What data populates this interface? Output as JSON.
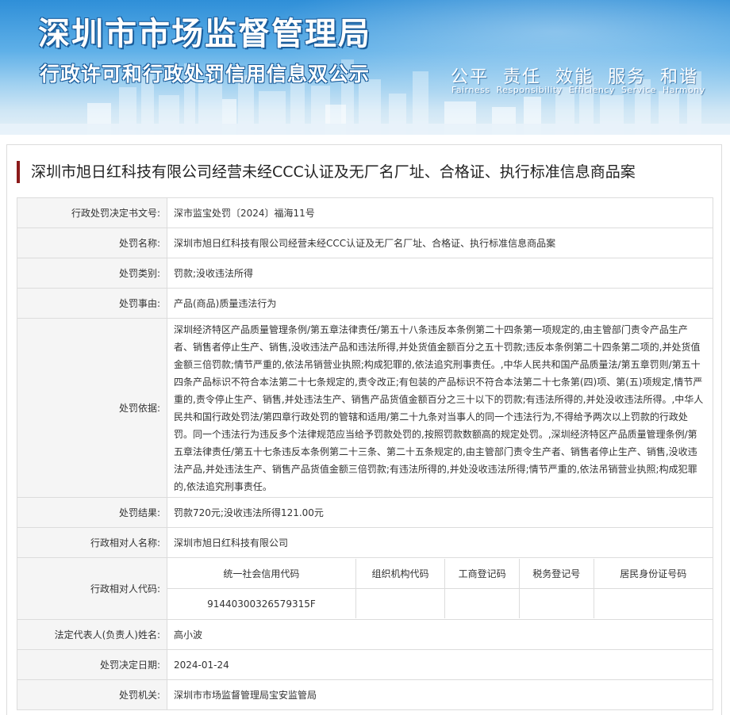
{
  "banner": {
    "title": "深圳市市场监督管理局",
    "subtitle": "行政许可和行政处罚信用信息双公示",
    "values_cn": "公平  责任  效能  服务  和谐",
    "values_en": "Fairness  Responsibility  Efficiency  Service  Harmony"
  },
  "case_title": "深圳市旭日红科技有限公司经营未经CCC认证及无厂名厂址、合格证、执行标准信息商品案",
  "rows": {
    "doc_no": {
      "label": "行政处罚决定书文号:",
      "value": "深市监宝处罚〔2024〕福海11号"
    },
    "name": {
      "label": "处罚名称:",
      "value": "深圳市旭日红科技有限公司经营未经CCC认证及无厂名厂址、合格证、执行标准信息商品案"
    },
    "category": {
      "label": "处罚类别:",
      "value": "罚款;没收违法所得"
    },
    "reason": {
      "label": "处罚事由:",
      "value": "产品(商品)质量违法行为"
    },
    "basis": {
      "label": "处罚依据:",
      "value": "深圳经济特区产品质量管理条例/第五章法律责任/第五十八条违反本条例第二十四条第一项规定的,由主管部门责令产品生产者、销售者停止生产、销售,没收违法产品和违法所得,并处货值金额百分之五十罚款;违反本条例第二十四条第二项的,并处货值金额三倍罚款;情节严重的,依法吊销营业执照;构成犯罪的,依法追究刑事责任。,中华人民共和国产品质量法/第五章罚则/第五十四条产品标识不符合本法第二十七条规定的,责令改正;有包装的产品标识不符合本法第二十七条第(四)项、第(五)项规定,情节严重的,责令停止生产、销售,并处违法生产、销售产品货值金额百分之三十以下的罚款;有违法所得的,并处没收违法所得。,中华人民共和国行政处罚法/第四章行政处罚的管辖和适用/第二十九条对当事人的同一个违法行为,不得给予两次以上罚款的行政处罚。同一个违法行为违反多个法律规范应当给予罚款处罚的,按照罚款数额高的规定处罚。,深圳经济特区产品质量管理条例/第五章法律责任/第五十七条违反本条例第二十三条、第二十五条规定的,由主管部门责令生产者、销售者停止生产、销售,没收违法产品,并处违法生产、销售产品货值金额三倍罚款;有违法所得的,并处没收违法所得;情节严重的,依法吊销营业执照;构成犯罪的,依法追究刑事责任。"
    },
    "result": {
      "label": "处罚结果:",
      "value": "罚款720元;没收违法所得121.00元"
    },
    "party_name": {
      "label": "行政相对人名称:",
      "value": "深圳市旭日红科技有限公司"
    },
    "party_code": {
      "label": "行政相对人代码:",
      "headers": [
        "统一社会信用代码",
        "组织机构代码",
        "工商登记码",
        "税务登记号",
        "居民身份证号码"
      ],
      "values": [
        "91440300326579315F",
        "",
        "",
        "",
        ""
      ]
    },
    "legal_rep": {
      "label": "法定代表人(负责人)姓名:",
      "value": "高小波"
    },
    "decision_date": {
      "label": "处罚决定日期:",
      "value": "2024-01-24"
    },
    "authority": {
      "label": "处罚机关:",
      "value": "深圳市市场监督管理局宝安监管局"
    }
  }
}
